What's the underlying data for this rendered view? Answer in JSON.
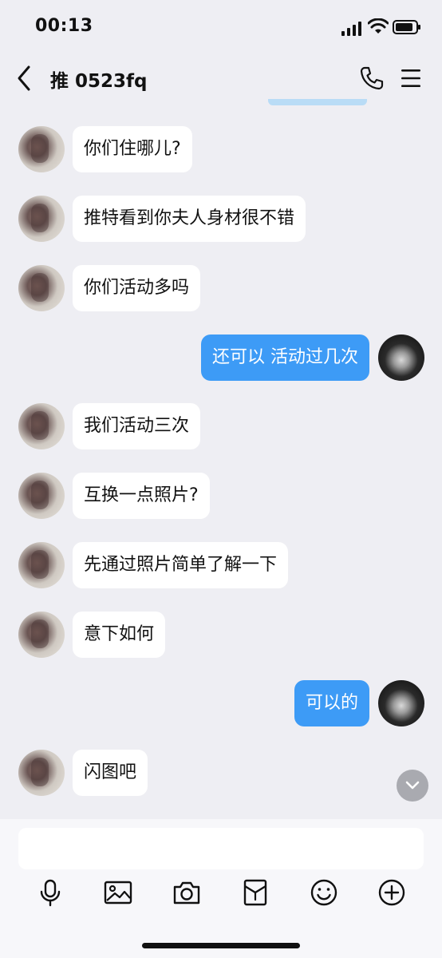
{
  "status_bar": {
    "time": "00:13"
  },
  "header": {
    "title": "推 0523fq"
  },
  "messages": [
    {
      "direction": "incoming",
      "text": "你们住哪儿?"
    },
    {
      "direction": "incoming",
      "text": "推特看到你夫人身材很不错"
    },
    {
      "direction": "incoming",
      "text": "你们活动多吗"
    },
    {
      "direction": "outgoing",
      "text": "还可以 活动过几次"
    },
    {
      "direction": "incoming",
      "text": "我们活动三次"
    },
    {
      "direction": "incoming",
      "text": "互换一点照片?"
    },
    {
      "direction": "incoming",
      "text": "先通过照片简单了解一下"
    },
    {
      "direction": "incoming",
      "text": "意下如何"
    },
    {
      "direction": "outgoing",
      "text": "可以的"
    },
    {
      "direction": "incoming",
      "text": "闪图吧"
    }
  ],
  "input": {
    "value": "",
    "placeholder": ""
  },
  "toolbar": {
    "icons": [
      "microphone-icon",
      "image-icon",
      "camera-icon",
      "red-packet-icon",
      "emoji-icon",
      "plus-icon"
    ]
  },
  "colors": {
    "background": "#eeeef3",
    "incoming_bubble": "#ffffff",
    "outgoing_bubble": "#3d9bf6",
    "outgoing_text": "#ffffff"
  }
}
